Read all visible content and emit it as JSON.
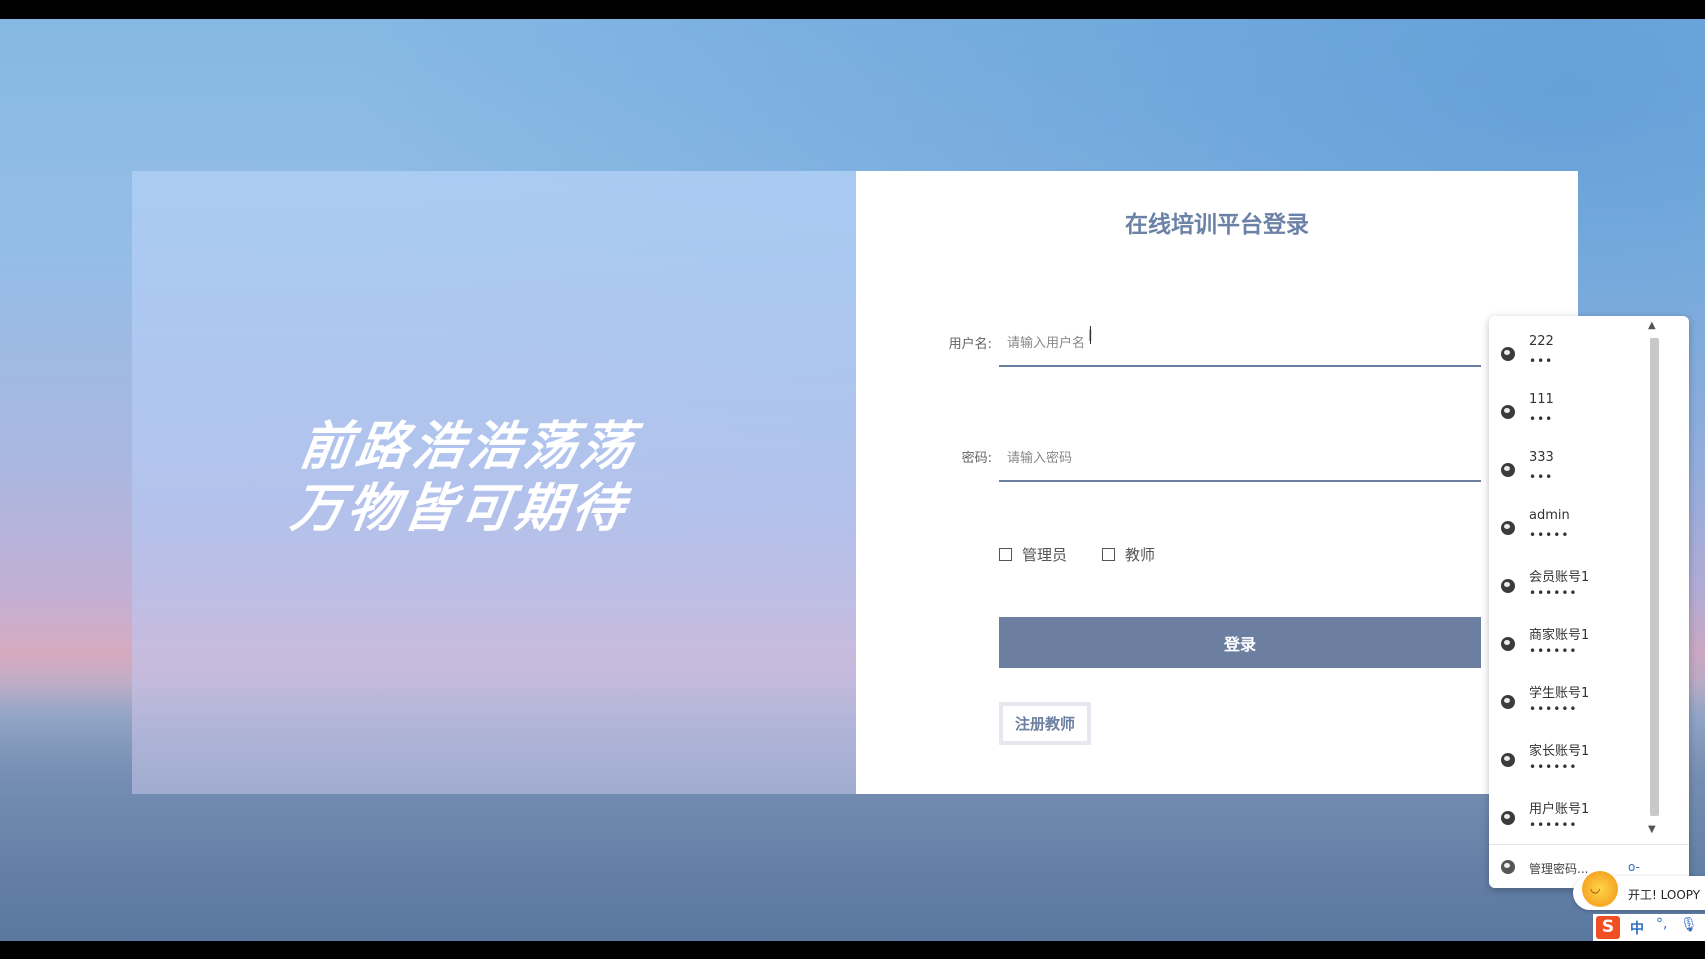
{
  "slogan": {
    "line1": "前路浩浩荡荡",
    "line2": "万物皆可期待"
  },
  "login": {
    "title": "在线培训平台登录",
    "username_label": "用户名:",
    "username_placeholder": "请输入用户名",
    "username_value": "",
    "password_label": "密码:",
    "password_placeholder": "请输入密码",
    "password_value": "",
    "roles": [
      {
        "label": "管理员",
        "checked": false
      },
      {
        "label": "教师",
        "checked": false
      }
    ],
    "submit_label": "登录",
    "register_label": "注册教师"
  },
  "autofill": {
    "accounts": [
      {
        "user": "222",
        "password": "•••"
      },
      {
        "user": "111",
        "password": "•••"
      },
      {
        "user": "333",
        "password": "•••"
      },
      {
        "user": "admin",
        "password": "•••••"
      },
      {
        "user": "会员账号1",
        "password": "••••••"
      },
      {
        "user": "商家账号1",
        "password": "••••••"
      },
      {
        "user": "学生账号1",
        "password": "••••••"
      },
      {
        "user": "家长账号1",
        "password": "••••••"
      },
      {
        "user": "用户账号1",
        "password": "••••••"
      }
    ],
    "manage_label": "管理密码...",
    "account_icon": "globe-icon",
    "manage_icon": "key-icon"
  },
  "tray": {
    "notification_text": "开工! LOOPY",
    "ime_logo": "S",
    "ime_mode": "中",
    "ime_punct": "°,",
    "ime_mic_icon": "microphone-icon"
  },
  "colors": {
    "accent": "#6d7fa1",
    "title": "#6b82a6"
  }
}
